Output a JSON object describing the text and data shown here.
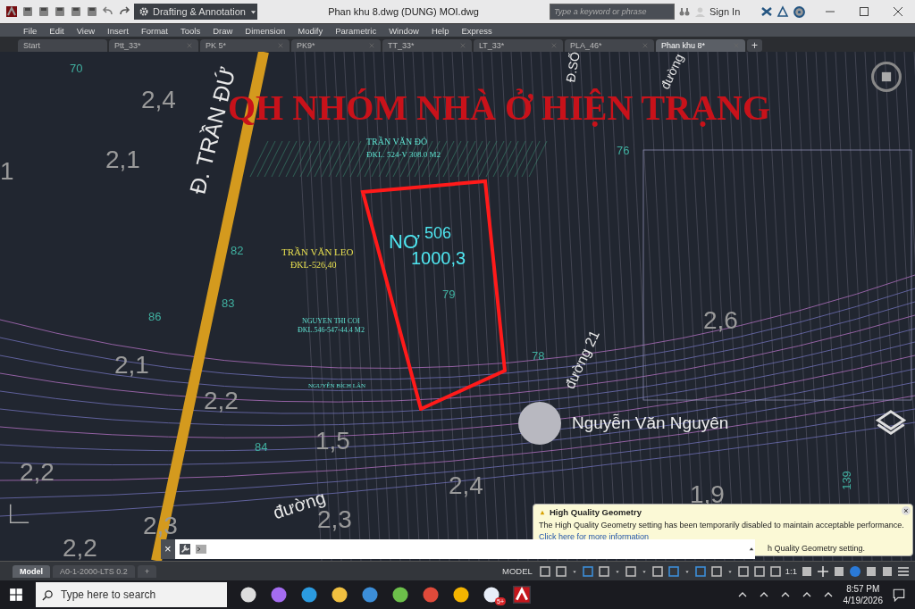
{
  "title_bar": {
    "workspace": "Drafting & Annotation",
    "title": "Phan khu 8.dwg (DUNG) MOI.dwg",
    "search": {
      "placeholder": "Type a keyword or phrase"
    },
    "sign_in": "Sign In"
  },
  "menu": [
    "File",
    "Edit",
    "View",
    "Insert",
    "Format",
    "Tools",
    "Draw",
    "Dimension",
    "Modify",
    "Parametric",
    "Window",
    "Help",
    "Express"
  ],
  "file_tabs": [
    {
      "label": "Start",
      "selected": false
    },
    {
      "label": "Ptt_33*",
      "selected": false
    },
    {
      "label": "PK 5*",
      "selected": false
    },
    {
      "label": "PK9*",
      "selected": false
    },
    {
      "label": "TT_33*",
      "selected": false
    },
    {
      "label": "LT_33*",
      "selected": false
    },
    {
      "label": "PLA_46*",
      "selected": false
    },
    {
      "label": "Phan khu 8*",
      "selected": true
    }
  ],
  "new_tab": "+",
  "drawing": {
    "labels": [
      {
        "kind": "street",
        "text": "Đ. TRẦN ĐỨ"
      },
      {
        "kind": "street",
        "text": "Đ.SỐ"
      },
      {
        "kind": "street",
        "text": "đường"
      },
      {
        "kind": "number",
        "text": "70"
      },
      {
        "kind": "height",
        "text": "2,4"
      },
      {
        "kind": "title",
        "text": "QH NHÓM NHÀ Ở HIỆN TRẠNG"
      },
      {
        "kind": "height",
        "text": "1"
      },
      {
        "kind": "height",
        "text": "2,1"
      },
      {
        "kind": "owner",
        "text": "TRẦN VĂN ĐỎ"
      },
      {
        "kind": "owner",
        "text": "ĐKL. 524-V 308.0 M2"
      },
      {
        "kind": "number",
        "text": "76"
      },
      {
        "kind": "number",
        "text": "82"
      },
      {
        "kind": "owner-hl",
        "text": "TRẦN VĂN LEO"
      },
      {
        "kind": "owner-hl",
        "text": "ĐKL-526,40"
      },
      {
        "kind": "lot",
        "text": "NƠ"
      },
      {
        "kind": "lot",
        "text": "506"
      },
      {
        "kind": "lot",
        "text": "1000,3"
      },
      {
        "kind": "number",
        "text": "79"
      },
      {
        "kind": "number",
        "text": "83"
      },
      {
        "kind": "number",
        "text": "86"
      },
      {
        "kind": "owner",
        "text": "NGUYEN THI COI"
      },
      {
        "kind": "owner",
        "text": "ĐKL.546-547-44.4 M2"
      },
      {
        "kind": "height",
        "text": "2,6"
      },
      {
        "kind": "height",
        "text": "2,1"
      },
      {
        "kind": "number",
        "text": "78"
      },
      {
        "kind": "street",
        "text": "đường 21"
      },
      {
        "kind": "height",
        "text": "2,2"
      },
      {
        "kind": "owner",
        "text": "NGUYỄN BÍCH LÂN"
      },
      {
        "kind": "number",
        "text": "84"
      },
      {
        "kind": "height",
        "text": "1,5"
      },
      {
        "kind": "height",
        "text": "2,2"
      },
      {
        "kind": "height",
        "text": "2,4"
      },
      {
        "kind": "number",
        "text": "139"
      },
      {
        "kind": "height",
        "text": "1,9"
      },
      {
        "kind": "height",
        "text": "2,2"
      },
      {
        "kind": "height",
        "text": "2,3"
      },
      {
        "kind": "street",
        "text": "đường"
      },
      {
        "kind": "height",
        "text": "2,3"
      }
    ]
  },
  "overlay": {
    "name": "Nguyễn Văn Nguyên"
  },
  "notification": {
    "title": "High Quality Geometry",
    "body": "The High Quality Geometry setting has been temporarily disabled to maintain acceptable performance.",
    "link": "Click here for more information",
    "tail": "h Quality Geometry setting.",
    "close": "×"
  },
  "command_line": {
    "close": "×"
  },
  "layout_tabs": [
    {
      "label": "Model",
      "selected": true
    },
    {
      "label": "A0-1-2000-LTS 0.2",
      "selected": false
    }
  ],
  "layout_add": "+",
  "status_bar": {
    "model": "MODEL",
    "scale": "1:1"
  },
  "taskbar": {
    "search": {
      "placeholder": "Type here to search"
    },
    "time": "8:57 PM",
    "date": "4/19/2026",
    "badge": "5+"
  }
}
